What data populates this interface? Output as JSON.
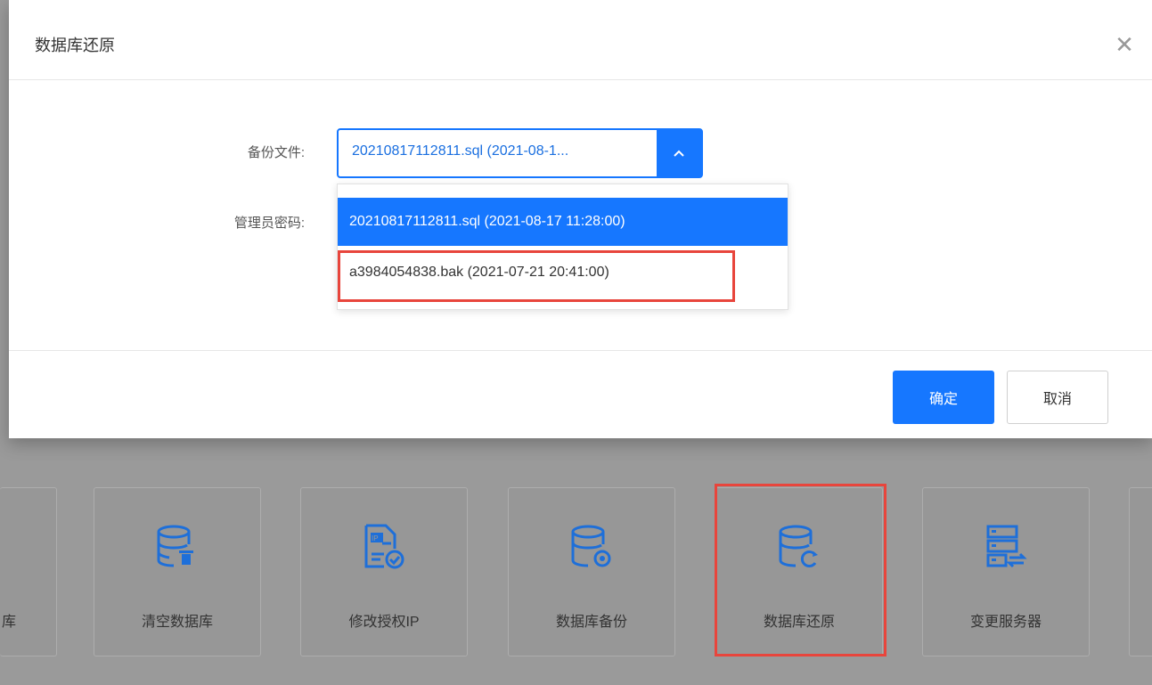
{
  "modal": {
    "title": "数据库还原",
    "close_glyph": "✕",
    "form": {
      "backup_label": "备份文件:",
      "password_label": "管理员密码:",
      "selected_value": "20210817112811.sql  (2021-08-1...",
      "options": [
        "20210817112811.sql  (2021-08-17 11:28:00)",
        "a3984054838.bak  (2021-07-21 20:41:00)"
      ]
    },
    "ok_label": "确定",
    "cancel_label": "取消"
  },
  "tiles": {
    "partial_left_label": "库",
    "items": [
      {
        "label": "清空数据库",
        "icon": "database-delete-icon"
      },
      {
        "label": "修改授权IP",
        "icon": "ip-document-icon"
      },
      {
        "label": "数据库备份",
        "icon": "database-backup-icon"
      },
      {
        "label": "数据库还原",
        "icon": "database-restore-icon"
      },
      {
        "label": "变更服务器",
        "icon": "server-switch-icon"
      }
    ]
  },
  "colors": {
    "primary": "#1677ff",
    "highlight": "#e8453c",
    "icon": "#1e6fd9"
  }
}
